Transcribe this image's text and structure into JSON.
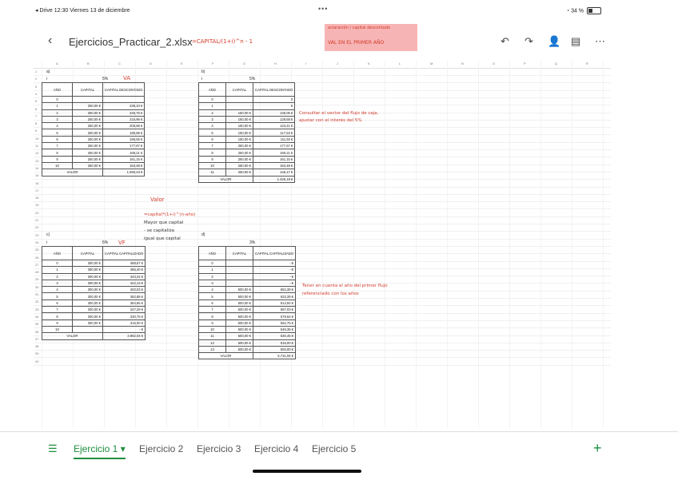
{
  "status": {
    "left": "◂ Drive  12:30  Viernes 13 de diciembre",
    "dots": "•••",
    "battery": "34 %"
  },
  "header": {
    "back": "‹",
    "filename": "Ejercicios_Practicar_2.xlsx"
  },
  "toolbar_icons": [
    "undo-icon",
    "redo-icon",
    "add-person-icon",
    "comment-icon",
    "more-icon"
  ],
  "columns": [
    "A",
    "B",
    "C",
    "D",
    "E",
    "F",
    "G",
    "H",
    "I",
    "J",
    "K",
    "L",
    "M",
    "N",
    "O",
    "P",
    "Q",
    "R",
    "S"
  ],
  "rows": [
    "1",
    "2",
    "3",
    "4",
    "5",
    "6",
    "7",
    "8",
    "9",
    "10",
    "11",
    "12",
    "13",
    "14",
    "15",
    "16",
    "17",
    "18",
    "19",
    "20",
    "21",
    "22",
    "23",
    "24",
    "25",
    "26",
    "27",
    "28",
    "29",
    "30",
    "31",
    "32",
    "33",
    "34",
    "35",
    "36",
    "37",
    "38",
    "39",
    "40"
  ],
  "table_a": {
    "label": "a)",
    "i_label": "i",
    "rate": "5%",
    "headers": [
      "AÑO",
      "CAPITAL",
      "CAPITAL DESCONTADO"
    ],
    "rows": [
      [
        "0",
        "",
        ""
      ],
      [
        "1",
        "250,00 €",
        "238,10 €"
      ],
      [
        "2",
        "250,00 €",
        "226,76 €"
      ],
      [
        "3",
        "250,00 €",
        "215,96 €"
      ],
      [
        "4",
        "250,00 €",
        "205,68 €"
      ],
      [
        "5",
        "250,00 €",
        "195,88 €"
      ],
      [
        "6",
        "250,00 €",
        "186,55 €"
      ],
      [
        "7",
        "250,00 €",
        "177,67 €"
      ],
      [
        "8",
        "250,00 €",
        "169,21 €"
      ],
      [
        "9",
        "250,00 €",
        "161,15 €"
      ],
      [
        "10",
        "250,00 €",
        "153,48 €"
      ]
    ],
    "total_label": "VALOR",
    "total": "1.930,43 €"
  },
  "table_b": {
    "label": "b)",
    "i_label": "i",
    "rate": "5%",
    "headers": [
      "AÑO",
      "CAPITAL",
      "CAPITAL DESCONTADO"
    ],
    "rows": [
      [
        "0",
        "",
        "0"
      ],
      [
        "1",
        "-",
        "€"
      ],
      [
        "2",
        "150,00 €",
        "136,05 €"
      ],
      [
        "3",
        "150,00 €",
        "129,58 €"
      ],
      [
        "4",
        "150,00 €",
        "123,41 €"
      ],
      [
        "5",
        "150,00 €",
        "117,53 €"
      ],
      [
        "6",
        "150,00 €",
        "111,93 €"
      ],
      [
        "7",
        "250,00 €",
        "177,67 €"
      ],
      [
        "8",
        "250,00 €",
        "169,21 €"
      ],
      [
        "9",
        "250,00 €",
        "161,15 €"
      ],
      [
        "10",
        "250,00 €",
        "153,48 €"
      ],
      [
        "11",
        "250,00 €",
        "146,17 €"
      ]
    ],
    "total_label": "VALOR",
    "total": "1.426,18 €"
  },
  "table_c": {
    "label": "c)",
    "i_label": "i",
    "rate": "5%",
    "headers": [
      "AÑO",
      "CAPITAL",
      "CAPITAL CAPITALIZADO"
    ],
    "rows": [
      [
        "0",
        "300,00 €",
        "488,67 €"
      ],
      [
        "1",
        "300,00 €",
        "465,40 €"
      ],
      [
        "2",
        "300,00 €",
        "443,24 €"
      ],
      [
        "3",
        "300,00 €",
        "422,13 €"
      ],
      [
        "4",
        "300,00 €",
        "402,03 €"
      ],
      [
        "5",
        "300,00 €",
        "382,88 €"
      ],
      [
        "6",
        "300,00 €",
        "364,65 €"
      ],
      [
        "7",
        "300,00 €",
        "347,29 €"
      ],
      [
        "8",
        "300,00 €",
        "330,75 €"
      ],
      [
        "9",
        "300,00 €",
        "315,00 €"
      ],
      [
        "10",
        "",
        "-  €"
      ]
    ],
    "total_label": "VALOR",
    "total": "3.962,04 €"
  },
  "table_d": {
    "label": "d)",
    "i_label": "",
    "rate": "3%",
    "headers": [
      "AÑO",
      "CAPITAL",
      "CAPITAL CAPITALIZADO"
    ],
    "rows": [
      [
        "0",
        "",
        "-  €"
      ],
      [
        "1",
        "",
        "-  €"
      ],
      [
        "2",
        "",
        "-  €"
      ],
      [
        "3",
        "",
        "-  €"
      ],
      [
        "4",
        "500,00 €",
        "652,39 €"
      ],
      [
        "5",
        "500,00 €",
        "633,39 €"
      ],
      [
        "6",
        "500,00 €",
        "614,94 €"
      ],
      [
        "7",
        "500,00 €",
        "597,03 €"
      ],
      [
        "8",
        "500,00 €",
        "579,64 €"
      ],
      [
        "9",
        "500,00 €",
        "562,75 €"
      ],
      [
        "10",
        "500,00 €",
        "546,36 €"
      ],
      [
        "11",
        "500,00 €",
        "530,45 €"
      ],
      [
        "12",
        "500,00 €",
        "515,00 €"
      ],
      [
        "13",
        "500,00 €",
        "500,00 €"
      ]
    ],
    "total_label": "VALOR",
    "total": "5.731,94 €"
  },
  "annotations": {
    "formula_top": "=CAPITAL/(1+i)^n - 1",
    "va": "VA",
    "note_pink": "aclaración / capital descontado",
    "note_pink2": "VAL EN EL PRIMER AÑO",
    "note_right_1": "Consultar el vector del flujo de caja,",
    "note_right_2": "ajustar con el interés del 5%",
    "valor": "Valor",
    "vf": "VF",
    "mid_note_1": "=capital*(1+i)^(n-año)",
    "mid_note_2": "Mayor que capital",
    "mid_note_3": "- se capitaliza",
    "mid_note_4": "igual que capital",
    "note_d_1": "Tener en cuenta el año del primer flujo",
    "note_d_2": "referenciado con los años"
  },
  "tabs": [
    {
      "label": "Ejercicio 1 ▾",
      "active": true
    },
    {
      "label": "Ejercicio 2",
      "active": false
    },
    {
      "label": "Ejercicio 3",
      "active": false
    },
    {
      "label": "Ejercicio 4",
      "active": false
    },
    {
      "label": "Ejercicio 5",
      "active": false
    }
  ],
  "add_sheet": "+",
  "accent": "#1e8e3e",
  "ink_color": "#d23a2a"
}
